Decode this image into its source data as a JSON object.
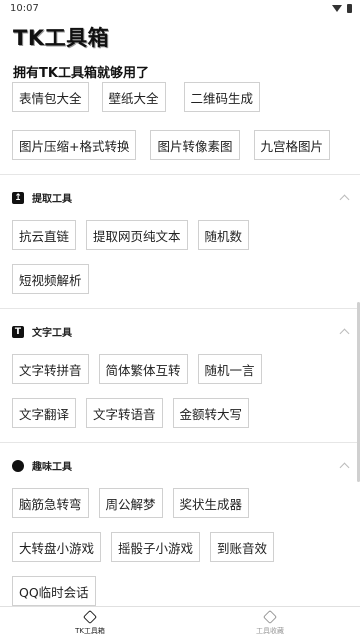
{
  "status": {
    "time": "10:07"
  },
  "header": {
    "title": "TK工具箱",
    "subtitle": "拥有TK工具箱就够用了"
  },
  "top_group": {
    "row1": [
      "表情包大全",
      "壁纸大全",
      "二维码生成"
    ],
    "row2": [
      "图片压缩+格式转换",
      "图片转像素图",
      "九宫格图片"
    ]
  },
  "sections": [
    {
      "title": "提取工具",
      "rows": [
        [
          "抗云直链",
          "提取网页纯文本",
          "随机数"
        ],
        [
          "短视频解析"
        ]
      ]
    },
    {
      "title": "文字工具",
      "rows": [
        [
          "文字转拼音",
          "简体繁体互转",
          "随机一言"
        ],
        [
          "文字翻译",
          "文字转语音",
          "金额转大写"
        ]
      ]
    },
    {
      "title": "趣味工具",
      "rows": [
        [
          "脑筋急转弯",
          "周公解梦",
          "奖状生成器"
        ],
        [
          "大转盘小游戏",
          "摇骰子小游戏",
          "到账音效"
        ],
        [
          "QQ临时会话"
        ]
      ]
    }
  ],
  "bottom_nav": {
    "tab1": "TK工具箱",
    "tab2": "工具收藏"
  }
}
